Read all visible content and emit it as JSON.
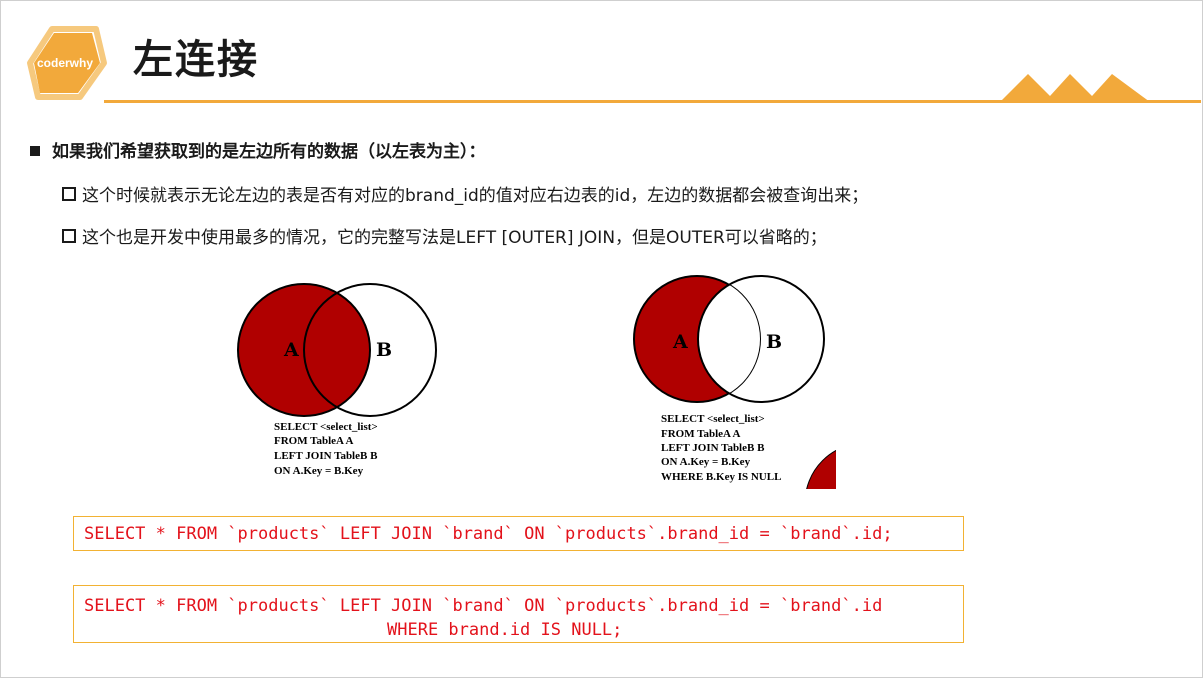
{
  "logo": {
    "text": "coderwhy"
  },
  "title": "左连接",
  "main_bullet": "如果我们希望获取到的是左边所有的数据（以左表为主）：",
  "sub_bullets": [
    "这个时候就表示无论左边的表是否有对应的brand_id的值对应右边表的id，左边的数据都会被查询出来；",
    "这个也是开发中使用最多的情况，它的完整写法是LEFT [OUTER] JOIN，但是OUTER可以省略的；"
  ],
  "diagram1": {
    "label_a": "A",
    "label_b": "B",
    "code": [
      "SELECT <select_list>",
      "FROM TableA A",
      "LEFT JOIN TableB B",
      "ON A.Key = B.Key"
    ]
  },
  "diagram2": {
    "label_a": "A",
    "label_b": "B",
    "code": [
      "SELECT <select_list>",
      "FROM TableA A",
      "LEFT JOIN TableB B",
      "ON A.Key = B.Key",
      "WHERE B.Key IS NULL"
    ]
  },
  "sql1": "SELECT * FROM `products` LEFT JOIN `brand` ON `products`.brand_id = `brand`.id;",
  "sql2": {
    "line1": "SELECT * FROM `products` LEFT JOIN `brand` ON `products`.brand_id = `brand`.id",
    "line2": "WHERE brand.id IS NULL;"
  },
  "colors": {
    "accent": "#f2a93b",
    "venn_red": "#b00000",
    "sql_red": "#e3121b"
  }
}
